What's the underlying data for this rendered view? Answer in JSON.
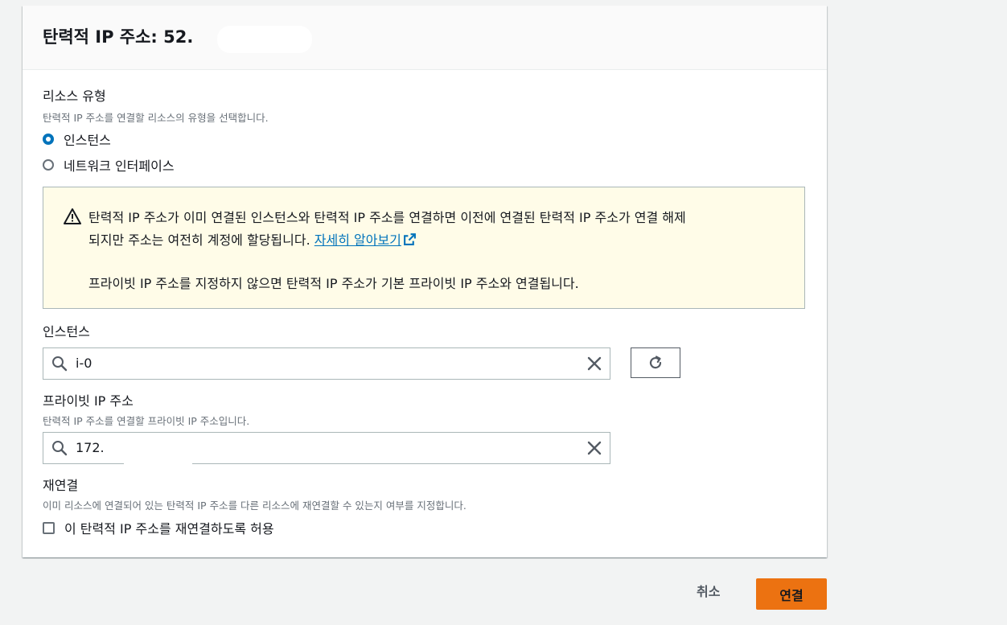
{
  "header": {
    "title": "탄력적 IP 주소: 52."
  },
  "resource_type": {
    "label": "리소스 유형",
    "description": "탄력적 IP 주소를 연결할 리소스의 유형을 선택합니다.",
    "options": [
      {
        "label": "인스턴스",
        "selected": true
      },
      {
        "label": "네트워크 인터페이스",
        "selected": false
      }
    ]
  },
  "alert": {
    "line1": "탄력적 IP 주소가 이미 연결된 인스턴스와 탄력적 IP 주소를 연결하면 이전에 연결된 탄력적 IP 주소가 연결 해제",
    "line2": "되지만 주소는 여전히 계정에 할당됩니다.",
    "link": "자세히 알아보기",
    "line3": "프라이빗 IP 주소를 지정하지 않으면 탄력적 IP 주소가 기본 프라이빗 IP 주소와 연결됩니다."
  },
  "instance": {
    "label": "인스턴스",
    "value": "i-0"
  },
  "private_ip": {
    "label": "프라이빗 IP 주소",
    "description": "탄력적 IP 주소를 연결할 프라이빗 IP 주소입니다.",
    "value": "172."
  },
  "reassociate": {
    "label": "재연결",
    "description": "이미 리소스에 연결되어 있는 탄력적 IP 주소를 다른 리소스에 재연결할 수 있는지 여부를 지정합니다.",
    "checkbox_label": "이 탄력적 IP 주소를 재연결하도록 허용",
    "checked": false
  },
  "footer": {
    "cancel": "취소",
    "submit": "연결"
  },
  "colors": {
    "primary": "#ec7211",
    "link": "#0073bb",
    "alert_bg": "#fffce8"
  }
}
